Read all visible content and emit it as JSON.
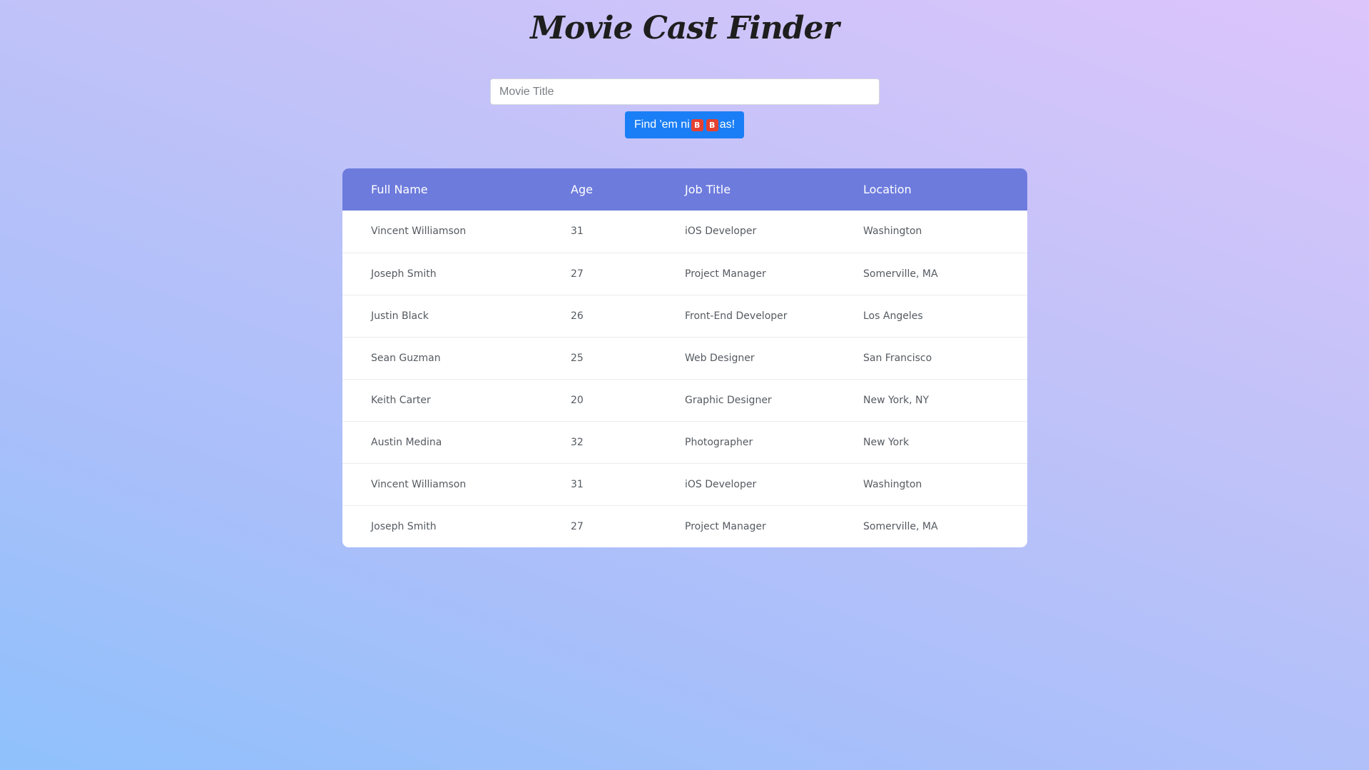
{
  "app": {
    "title": "Movie Cast Finder"
  },
  "search": {
    "placeholder": "Movie Title",
    "value": ""
  },
  "button": {
    "label_prefix": "Find 'em ni",
    "emoji_letter": "B",
    "label_suffix": "as!"
  },
  "table": {
    "headers": [
      "Full Name",
      "Age",
      "Job Title",
      "Location"
    ],
    "rows": [
      [
        "Vincent Williamson",
        "31",
        "iOS Developer",
        "Washington"
      ],
      [
        "Joseph Smith",
        "27",
        "Project Manager",
        "Somerville, MA"
      ],
      [
        "Justin Black",
        "26",
        "Front-End Developer",
        "Los Angeles"
      ],
      [
        "Sean Guzman",
        "25",
        "Web Designer",
        "San Francisco"
      ],
      [
        "Keith Carter",
        "20",
        "Graphic Designer",
        "New York, NY"
      ],
      [
        "Austin Medina",
        "32",
        "Photographer",
        "New York"
      ],
      [
        "Vincent Williamson",
        "31",
        "iOS Developer",
        "Washington"
      ],
      [
        "Joseph Smith",
        "27",
        "Project Manager",
        "Somerville, MA"
      ]
    ]
  },
  "colors": {
    "header_bg": "#6d7bdd",
    "button_bg": "#1a7ff6",
    "emoji_bg": "#e64130"
  }
}
